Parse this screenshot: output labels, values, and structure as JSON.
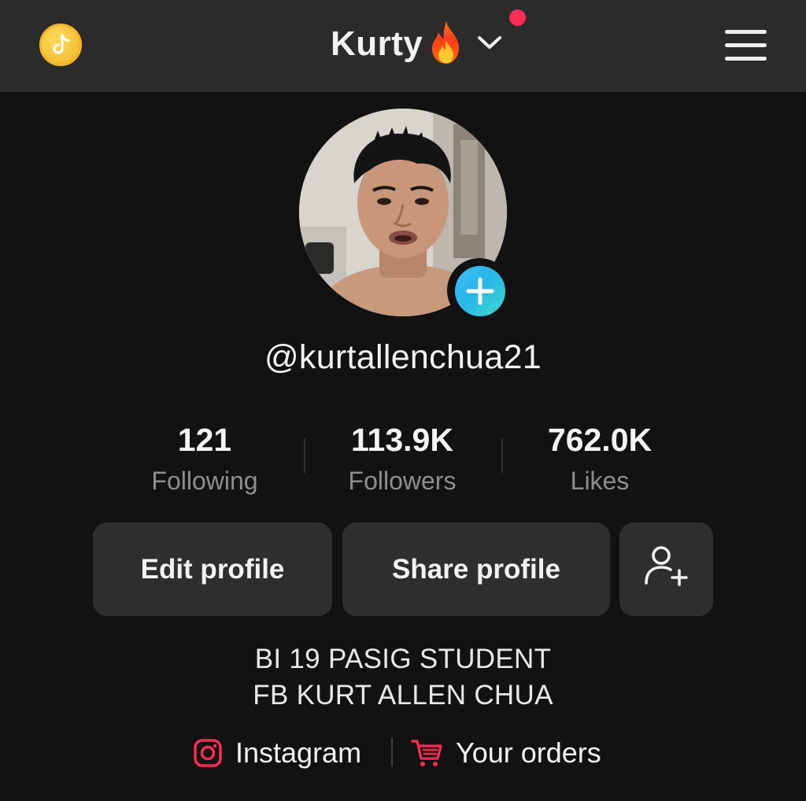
{
  "header": {
    "title": "Kurty",
    "notification_dot": true,
    "icons": {
      "coin": "tiktok-coin-icon",
      "flame": "fire-emoji",
      "dropdown": "chevron-down-icon",
      "menu": "hamburger-menu-icon"
    }
  },
  "profile": {
    "handle": "@kurtallenchua21",
    "avatar_icon": "profile-photo",
    "add_icon": "plus-icon"
  },
  "stats": [
    {
      "value": "121",
      "label": "Following"
    },
    {
      "value": "113.9K",
      "label": "Followers"
    },
    {
      "value": "762.0K",
      "label": "Likes"
    }
  ],
  "actions": {
    "edit_label": "Edit profile",
    "share_label": "Share profile",
    "add_friend_icon": "add-user-icon"
  },
  "bio": {
    "line1": "BI 19 PASIG STUDENT",
    "line2": "FB KURT ALLEN CHUA"
  },
  "links": {
    "instagram": "Instagram",
    "orders": "Your orders"
  },
  "colors": {
    "background": "#121212",
    "header_bg": "#2b2b2b",
    "button_bg": "#2e2e2e",
    "accent_red": "#fe2c55",
    "badge_cyan": "#2fb8ea",
    "muted_text": "#8e8e8e"
  }
}
